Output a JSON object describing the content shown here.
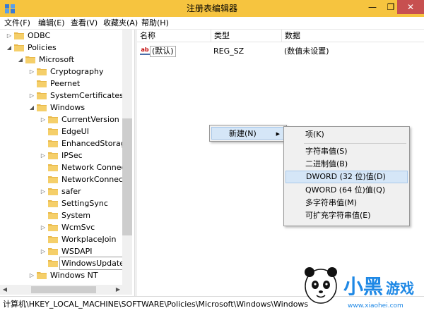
{
  "window": {
    "title": "注册表编辑器",
    "buttons": {
      "minimize": "—",
      "maximize": "❐",
      "close": "✕"
    }
  },
  "menubar": {
    "items": [
      "文件(F)",
      "编辑(E)",
      "查看(V)",
      "收藏夹(A)",
      "帮助(H)"
    ]
  },
  "tree": {
    "items": [
      {
        "label": "ODBC",
        "expander": "▷"
      },
      {
        "label": "Policies",
        "expander": "◢"
      },
      {
        "label": "Microsoft",
        "expander": "◢"
      },
      {
        "label": "Cryptography",
        "expander": "▷"
      },
      {
        "label": "Peernet",
        "expander": ""
      },
      {
        "label": "SystemCertificates",
        "expander": "▷"
      },
      {
        "label": "Windows",
        "expander": "◢"
      },
      {
        "label": "CurrentVersion",
        "expander": "▷"
      },
      {
        "label": "EdgeUI",
        "expander": ""
      },
      {
        "label": "EnhancedStorage",
        "expander": ""
      },
      {
        "label": "IPSec",
        "expander": "▷"
      },
      {
        "label": "Network Connect",
        "expander": ""
      },
      {
        "label": "NetworkConnecti",
        "expander": ""
      },
      {
        "label": "safer",
        "expander": "▷"
      },
      {
        "label": "SettingSync",
        "expander": ""
      },
      {
        "label": "System",
        "expander": ""
      },
      {
        "label": "WcmSvc",
        "expander": "▷"
      },
      {
        "label": "WorkplaceJoin",
        "expander": ""
      },
      {
        "label": "WSDAPI",
        "expander": "▷"
      },
      {
        "label": "WindowsUpdate",
        "expander": ""
      },
      {
        "label": "Windows NT",
        "expander": "▷"
      }
    ]
  },
  "list": {
    "columns": {
      "name": "名称",
      "type": "类型",
      "data": "数据"
    },
    "rows": [
      {
        "icon": "ab",
        "name": "(默认)",
        "type": "REG_SZ",
        "data": "(数值未设置)"
      }
    ]
  },
  "statusbar": {
    "path": "计算机\\HKEY_LOCAL_MACHINE\\SOFTWARE\\Policies\\Microsoft\\Windows\\Windows"
  },
  "context_menu": {
    "item": "新建(N)",
    "arrow": "▶"
  },
  "submenu": {
    "items": [
      {
        "label": "项(K)"
      },
      {
        "label": "字符串值(S)"
      },
      {
        "label": "二进制值(B)"
      },
      {
        "label": "DWORD (32 位)值(D)",
        "highlighted": true
      },
      {
        "label": "QWORD (64 位)值(Q)"
      },
      {
        "label": "多字符串值(M)"
      },
      {
        "label": "可扩充字符串值(E)"
      }
    ]
  },
  "colors": {
    "titlebar": "#f6c43f",
    "close_button": "#c75050",
    "menu_highlight": "#d5e6f7",
    "folder": "#e8b84a"
  },
  "watermark": {
    "brand": "小黑游戏",
    "url": "www.xiaohei.com"
  }
}
